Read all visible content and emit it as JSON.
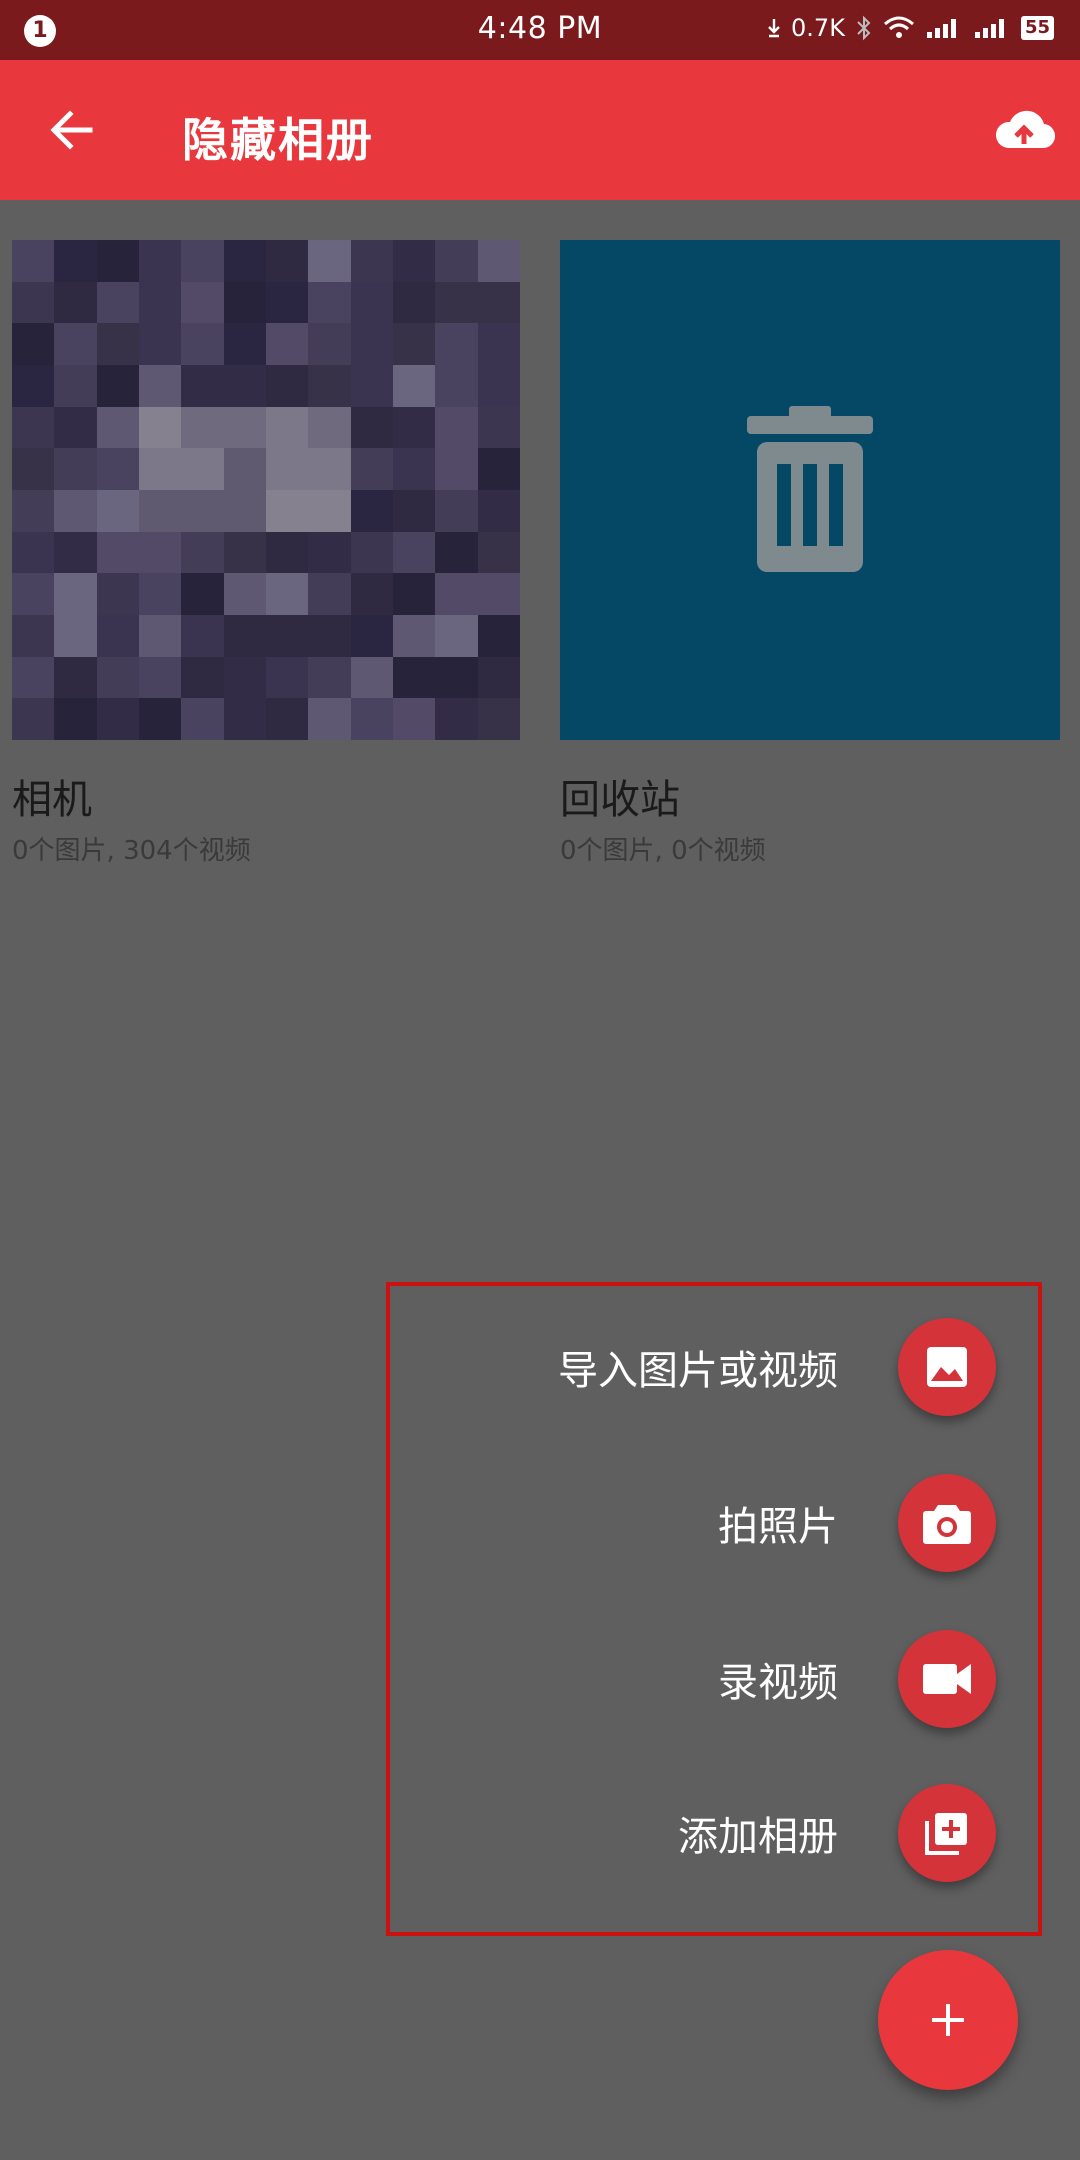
{
  "status_bar": {
    "notification_count": "1",
    "time": "4:48 PM",
    "network_speed": "0.7K",
    "battery": "55",
    "icons": [
      "download-arrow-icon",
      "bluetooth-icon",
      "wifi-icon",
      "signal-icon",
      "signal-2-icon",
      "battery-icon"
    ]
  },
  "app_bar": {
    "title": "隐藏相册",
    "back_icon": "arrow-left-icon",
    "action_icon": "cloud-upload-icon"
  },
  "albums": [
    {
      "name": "相机",
      "meta": "0个图片, 304个视频",
      "thumbnail": "pixelated-image"
    },
    {
      "name": "回收站",
      "meta": "0个图片, 0个视频",
      "thumbnail": "trash-icon"
    }
  ],
  "speed_dial": {
    "items": [
      {
        "label": "导入图片或视频",
        "icon": "image-icon"
      },
      {
        "label": "拍照片",
        "icon": "camera-icon"
      },
      {
        "label": "录视频",
        "icon": "videocam-icon"
      },
      {
        "label": "添加相册",
        "icon": "add-album-icon"
      }
    ],
    "main_fab_icon": "plus-icon"
  },
  "colors": {
    "app_bar": "#e8383d",
    "status_bar": "#7a1a1c",
    "scrim_background": "#5f5f5f",
    "trash_tile": "#054865",
    "fab": "#e8383d",
    "mini_fab": "#d4333a",
    "highlight_box": "#cc1111"
  }
}
